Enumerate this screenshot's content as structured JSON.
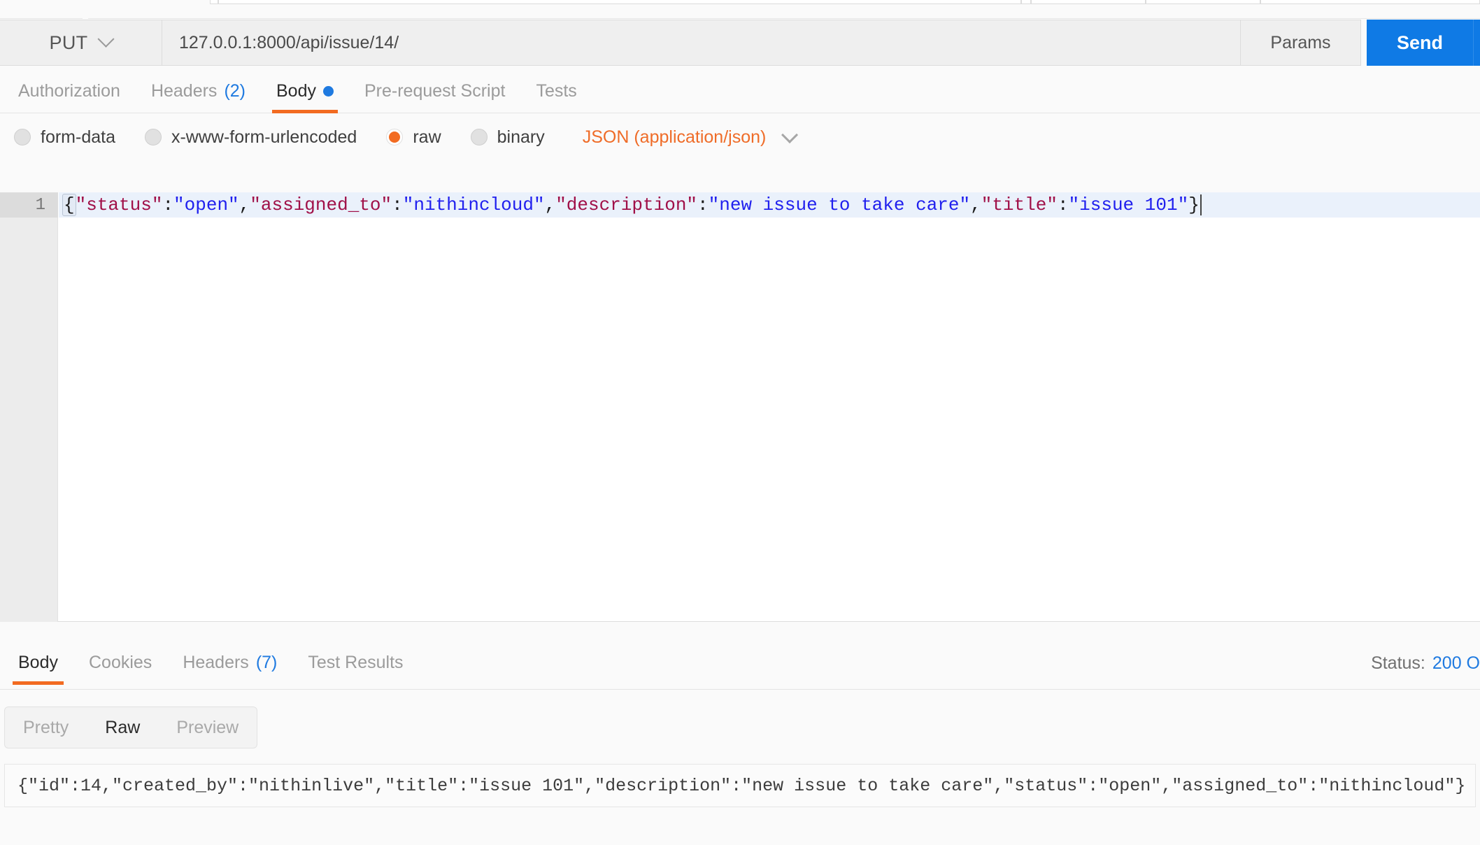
{
  "request": {
    "method": "PUT",
    "url": "127.0.0.1:8000/api/issue/14/",
    "url_placeholder": "Enter request URL",
    "params_label": "Params",
    "send_label": "Send",
    "tabs": [
      {
        "label": "Authorization",
        "badge": "",
        "active": false,
        "dot": false
      },
      {
        "label": "Headers",
        "badge": "(2)",
        "active": false,
        "dot": false
      },
      {
        "label": "Body",
        "badge": "",
        "active": true,
        "dot": true
      },
      {
        "label": "Pre-request Script",
        "badge": "",
        "active": false,
        "dot": false
      },
      {
        "label": "Tests",
        "badge": "",
        "active": false,
        "dot": false
      }
    ]
  },
  "body_options": {
    "items": [
      {
        "label": "form-data",
        "selected": false
      },
      {
        "label": "x-www-form-urlencoded",
        "selected": false
      },
      {
        "label": "raw",
        "selected": true
      },
      {
        "label": "binary",
        "selected": false
      }
    ],
    "content_type": "JSON (application/json)"
  },
  "editor": {
    "line_number": "1",
    "tokens": [
      {
        "t": "{",
        "c": "brace"
      },
      {
        "t": "\"status\"",
        "c": "key"
      },
      {
        "t": ":",
        "c": "punc"
      },
      {
        "t": "\"open\"",
        "c": "str"
      },
      {
        "t": ",",
        "c": "punc"
      },
      {
        "t": "\"assigned_to\"",
        "c": "key"
      },
      {
        "t": ":",
        "c": "punc"
      },
      {
        "t": "\"nithincloud\"",
        "c": "str"
      },
      {
        "t": ",",
        "c": "punc"
      },
      {
        "t": "\"description\"",
        "c": "key"
      },
      {
        "t": ":",
        "c": "punc"
      },
      {
        "t": "\"new issue to take care\"",
        "c": "str"
      },
      {
        "t": ",",
        "c": "punc"
      },
      {
        "t": "\"title\"",
        "c": "key"
      },
      {
        "t": ":",
        "c": "punc"
      },
      {
        "t": "\"issue 101\"",
        "c": "str"
      },
      {
        "t": "}",
        "c": "punc"
      }
    ],
    "raw_text": "{\"status\":\"open\",\"assigned_to\":\"nithincloud\",\"description\":\"new issue to take care\",\"title\":\"issue 101\"}"
  },
  "response": {
    "tabs": [
      {
        "label": "Body",
        "badge": "",
        "active": true
      },
      {
        "label": "Cookies",
        "badge": "",
        "active": false
      },
      {
        "label": "Headers",
        "badge": "(7)",
        "active": false
      },
      {
        "label": "Test Results",
        "badge": "",
        "active": false
      }
    ],
    "status_label": "Status:",
    "status_code": "200 O",
    "view_modes": [
      {
        "label": "Pretty",
        "active": false
      },
      {
        "label": "Raw",
        "active": true
      },
      {
        "label": "Preview",
        "active": false
      }
    ],
    "body_text": "{\"id\":14,\"created_by\":\"nithinlive\",\"title\":\"issue 101\",\"description\":\"new issue to take care\",\"status\":\"open\",\"assigned_to\":\"nithincloud\"}"
  },
  "colors": {
    "accent_orange": "#f26b21",
    "accent_blue": "#1f7ae0",
    "send_blue": "#0f7ae5",
    "json_key": "#a01048",
    "json_string": "#2020ee"
  }
}
